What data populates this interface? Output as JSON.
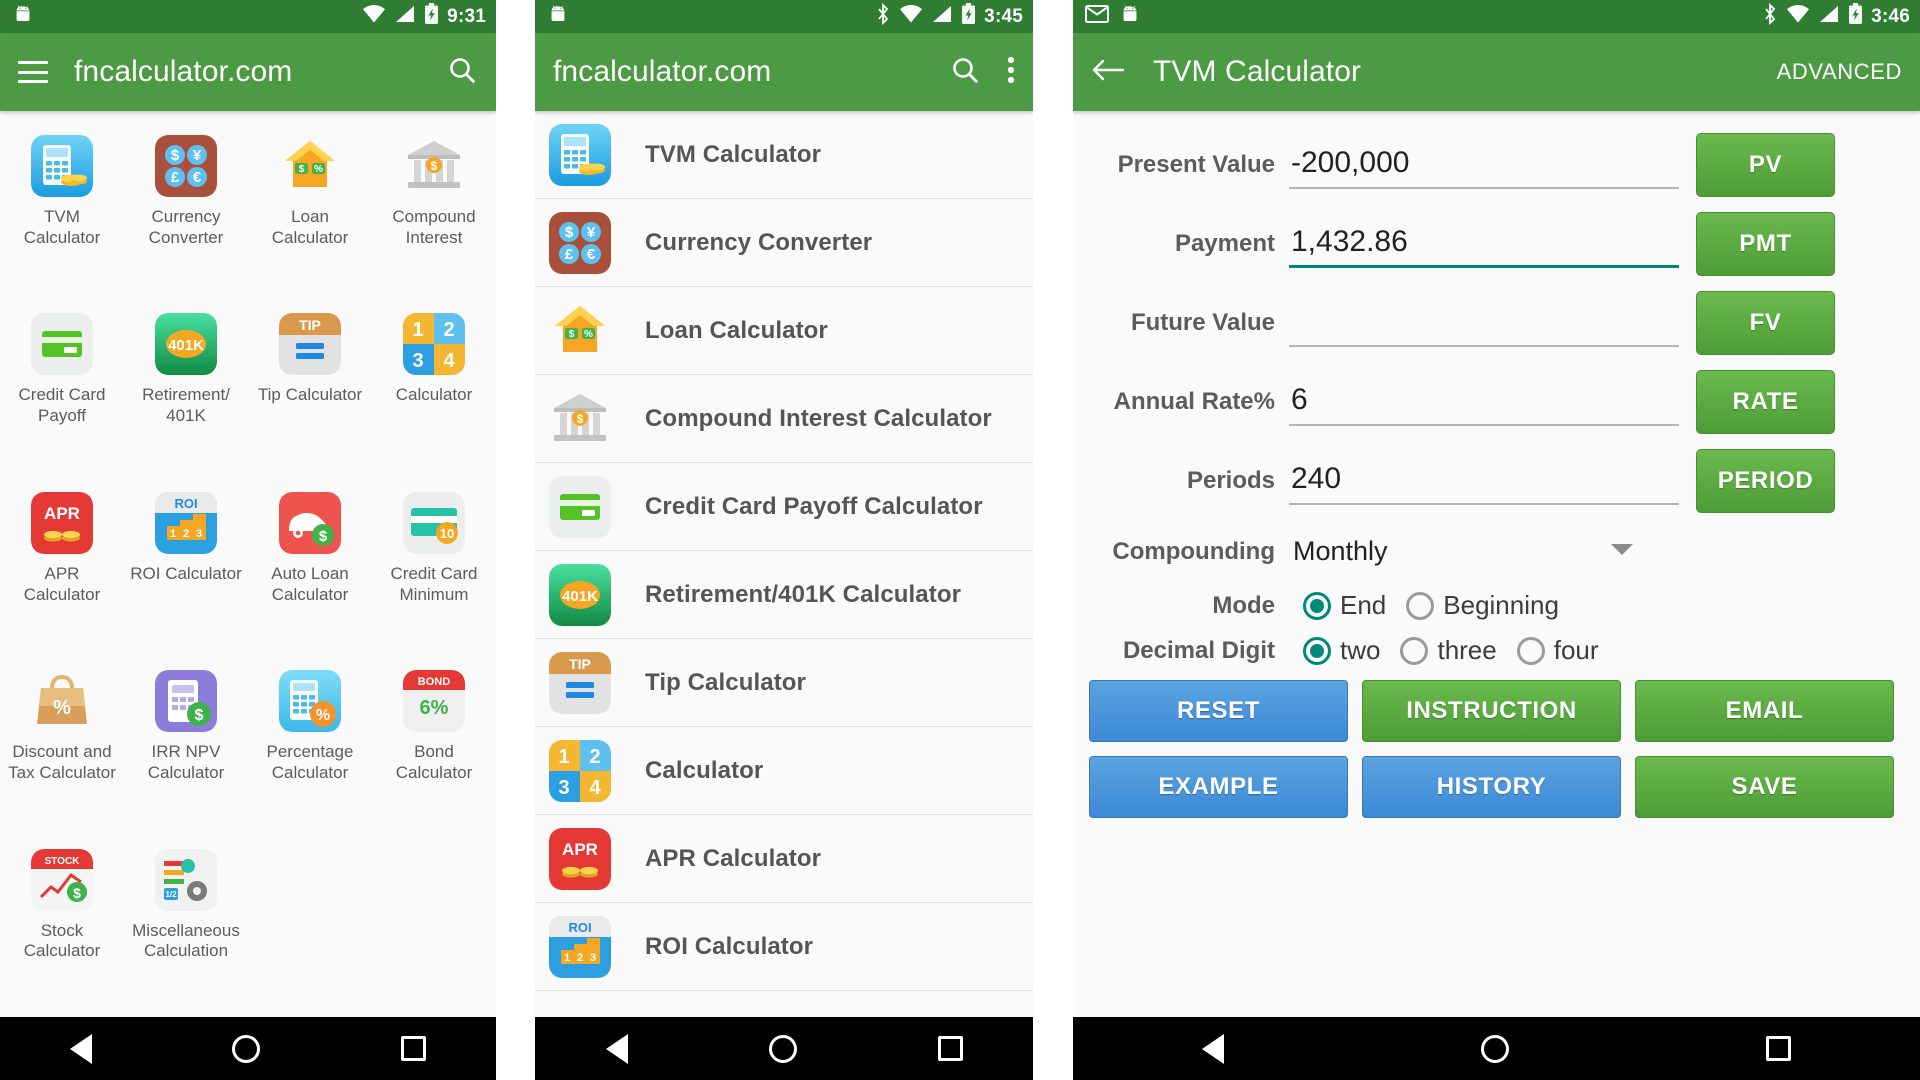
{
  "panels": [
    {
      "id": "home-grid",
      "statusbar": {
        "time": "9:31",
        "icons": [
          "android-icon",
          "wifi-icon",
          "signal-icon",
          "battery-charging-icon"
        ]
      },
      "appbar": {
        "title": "fncalculator.com",
        "menu_icon": "hamburger-icon",
        "search_icon": "search-icon"
      },
      "grid_items": [
        {
          "label": "TVM\nCalculator",
          "icon": "tvm-calculator-icon"
        },
        {
          "label": "Currency\nConverter",
          "icon": "currency-converter-icon"
        },
        {
          "label": "Loan\nCalculator",
          "icon": "loan-calculator-icon"
        },
        {
          "label": "Compound\nInterest",
          "icon": "compound-interest-icon"
        },
        {
          "label": "Credit Card\nPayoff",
          "icon": "credit-card-payoff-icon"
        },
        {
          "label": "Retirement/\n401K",
          "icon": "retirement-401k-icon"
        },
        {
          "label": "Tip Calculator",
          "icon": "tip-calculator-icon"
        },
        {
          "label": "Calculator",
          "icon": "calculator-icon"
        },
        {
          "label": "APR\nCalculator",
          "icon": "apr-calculator-icon"
        },
        {
          "label": "ROI Calculator",
          "icon": "roi-calculator-icon"
        },
        {
          "label": "Auto Loan\nCalculator",
          "icon": "auto-loan-calculator-icon"
        },
        {
          "label": "Credit Card\nMinimum",
          "icon": "credit-card-minimum-icon"
        },
        {
          "label": "Discount and\nTax Calculator",
          "icon": "discount-tax-icon"
        },
        {
          "label": "IRR NPV\nCalculator",
          "icon": "irr-npv-icon"
        },
        {
          "label": "Percentage\nCalculator",
          "icon": "percentage-calculator-icon"
        },
        {
          "label": "Bond\nCalculator",
          "icon": "bond-calculator-icon"
        },
        {
          "label": "Stock\nCalculator",
          "icon": "stock-calculator-icon"
        },
        {
          "label": "Miscellaneous\nCalculation",
          "icon": "miscellaneous-icon"
        }
      ]
    },
    {
      "id": "home-list",
      "statusbar": {
        "time": "3:45",
        "icons": [
          "android-icon",
          "bluetooth-icon",
          "wifi-icon",
          "signal-icon",
          "battery-charging-icon"
        ]
      },
      "appbar": {
        "title": "fncalculator.com",
        "search_icon": "search-icon",
        "overflow_icon": "more-vert-icon"
      },
      "list_items": [
        {
          "label": "TVM Calculator",
          "icon": "tvm-calculator-icon"
        },
        {
          "label": "Currency Converter",
          "icon": "currency-converter-icon"
        },
        {
          "label": "Loan Calculator",
          "icon": "loan-calculator-icon"
        },
        {
          "label": "Compound Interest Calculator",
          "icon": "compound-interest-icon"
        },
        {
          "label": "Credit Card Payoff Calculator",
          "icon": "credit-card-payoff-icon"
        },
        {
          "label": "Retirement/401K Calculator",
          "icon": "retirement-401k-icon"
        },
        {
          "label": "Tip Calculator",
          "icon": "tip-calculator-icon"
        },
        {
          "label": "Calculator",
          "icon": "calculator-icon"
        },
        {
          "label": "APR Calculator",
          "icon": "apr-calculator-icon"
        },
        {
          "label": "ROI Calculator",
          "icon": "roi-calculator-icon"
        }
      ]
    },
    {
      "id": "tvm-calculator",
      "statusbar": {
        "time": "3:46",
        "icons": [
          "gmail-icon",
          "android-icon",
          "bluetooth-icon",
          "wifi-icon",
          "signal-icon",
          "battery-charging-icon"
        ]
      },
      "appbar": {
        "back_icon": "arrow-back-icon",
        "title": "TVM Calculator",
        "action_label": "ADVANCED"
      },
      "fields": [
        {
          "label": "Present Value",
          "value": "-200,000",
          "button": "PV",
          "focused": false
        },
        {
          "label": "Payment",
          "value": "1,432.86",
          "button": "PMT",
          "focused": true
        },
        {
          "label": "Future Value",
          "value": "",
          "button": "FV",
          "focused": false
        },
        {
          "label": "Annual Rate%",
          "value": "6",
          "button": "RATE",
          "focused": false
        },
        {
          "label": "Periods",
          "value": "240",
          "button": "PERIOD",
          "focused": false
        }
      ],
      "compounding": {
        "label": "Compounding",
        "value": "Monthly",
        "caret_icon": "chevron-down-icon"
      },
      "mode": {
        "label": "Mode",
        "options": [
          {
            "label": "End",
            "selected": true
          },
          {
            "label": "Beginning",
            "selected": false
          }
        ]
      },
      "decimal_digit": {
        "label": "Decimal Digit",
        "options": [
          {
            "label": "two",
            "selected": true
          },
          {
            "label": "three",
            "selected": false
          },
          {
            "label": "four",
            "selected": false
          }
        ]
      },
      "action_buttons": [
        [
          {
            "label": "RESET",
            "style": "blue"
          },
          {
            "label": "INSTRUCTION",
            "style": "green"
          },
          {
            "label": "EMAIL",
            "style": "green"
          }
        ],
        [
          {
            "label": "EXAMPLE",
            "style": "blue"
          },
          {
            "label": "HISTORY",
            "style": "blue"
          },
          {
            "label": "SAVE",
            "style": "green"
          }
        ]
      ]
    }
  ],
  "navbar": {
    "back_icon": "nav-back-icon",
    "home_icon": "nav-home-icon",
    "recents_icon": "nav-recents-icon"
  },
  "colors": {
    "status_bar": "#2e7d32",
    "app_bar": "#4c9a43",
    "accent_teal": "#00897b",
    "blue_button": "#3c8ad6",
    "green_button": "#4e9c36"
  }
}
